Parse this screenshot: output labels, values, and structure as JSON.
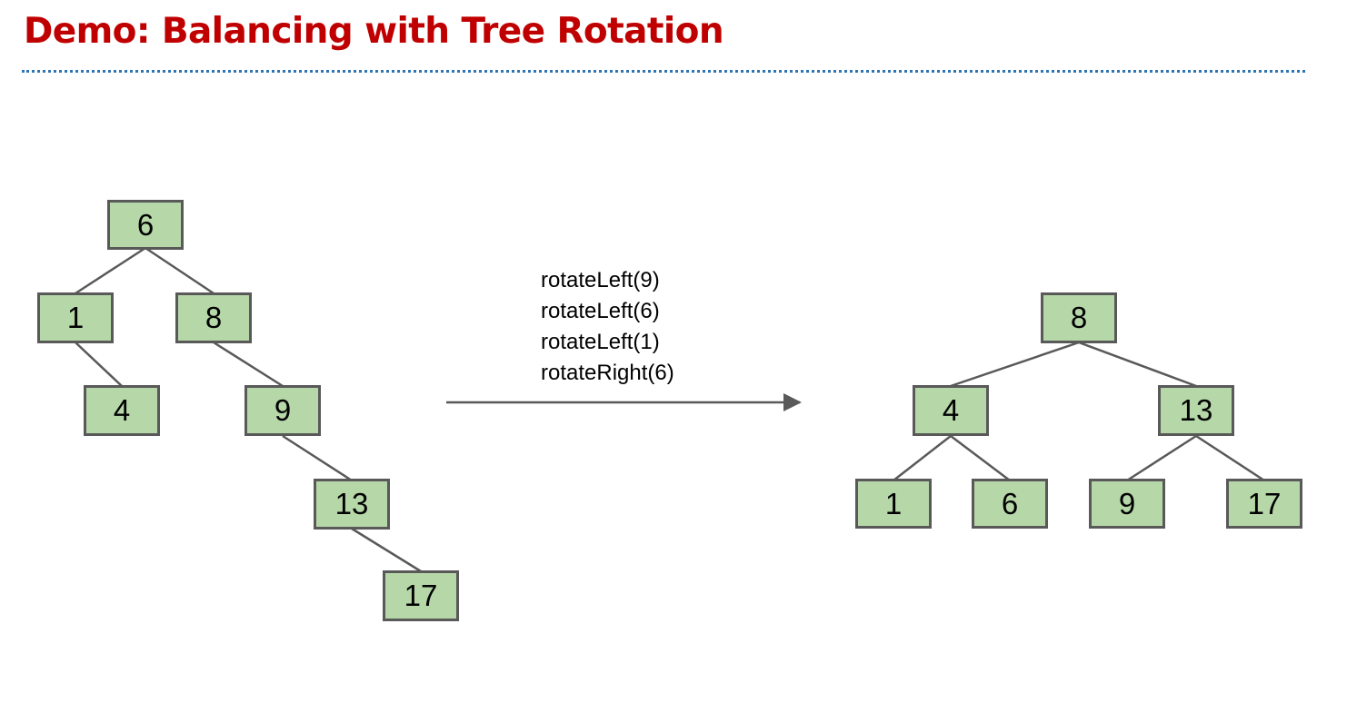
{
  "title": "Demo: Balancing with Tree Rotation",
  "colors": {
    "title": "#c00000",
    "rule": "#2e75b6",
    "node_fill": "#b6d7a8",
    "node_border": "#595959",
    "edge": "#595959"
  },
  "before_tree": {
    "nodes": [
      "6",
      "1",
      "8",
      "4",
      "9",
      "13",
      "17"
    ],
    "edges": [
      [
        "6",
        "1"
      ],
      [
        "6",
        "8"
      ],
      [
        "1",
        "4"
      ],
      [
        "8",
        "9"
      ],
      [
        "9",
        "13"
      ],
      [
        "13",
        "17"
      ]
    ]
  },
  "operations": [
    "rotateLeft(9)",
    "rotateLeft(6)",
    "rotateLeft(1)",
    "rotateRight(6)"
  ],
  "after_tree": {
    "nodes": [
      "8",
      "4",
      "13",
      "1",
      "6",
      "9",
      "17"
    ],
    "edges": [
      [
        "8",
        "4"
      ],
      [
        "8",
        "13"
      ],
      [
        "4",
        "1"
      ],
      [
        "4",
        "6"
      ],
      [
        "13",
        "9"
      ],
      [
        "13",
        "17"
      ]
    ]
  },
  "arrow_icon": "right-arrow"
}
